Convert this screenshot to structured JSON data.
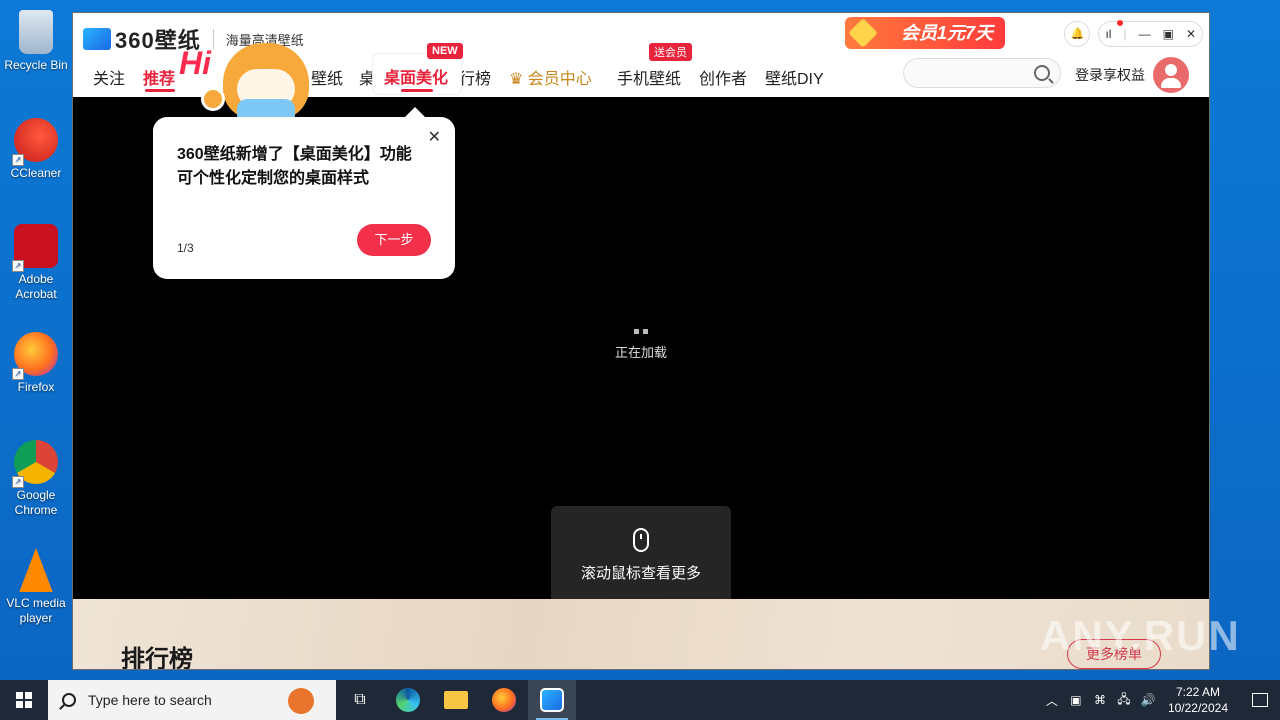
{
  "desktop": {
    "icons": [
      {
        "label": "Recycle Bin"
      },
      {
        "label": "CCleaner"
      },
      {
        "label": "Adobe Acrobat"
      },
      {
        "label": "Firefox"
      },
      {
        "label": "Google Chrome"
      },
      {
        "label": "VLC media player"
      }
    ]
  },
  "app": {
    "brand": "360壁纸",
    "slogan": "海量高清壁纸",
    "promo": "会员1元7天",
    "nav": {
      "follow": "关注",
      "recommend": "推荐",
      "hidden_wallpaper": "壁纸",
      "hidden_desk": "桌",
      "beauty": "桌面美化",
      "rank": "行榜",
      "vip": "会员中心",
      "mobile": "手机壁纸",
      "creator": "创作者",
      "diy": "壁纸DIY"
    },
    "tags": {
      "new": "NEW",
      "gift": "送会员"
    },
    "search_placeholder": "",
    "login": "登录享权益",
    "mascot_hi": "Hi",
    "popup": {
      "line1": "360壁纸新增了【桌面美化】功能",
      "line2": "可个性化定制您的桌面样式",
      "step": "1/3",
      "next": "下一步",
      "close": "✕"
    },
    "loading": "正在加载",
    "scroll_hint": "滚动鼠标查看更多",
    "ranking_title": "排行榜",
    "more_ranking": "更多榜单"
  },
  "watermark": "ANY.RUN",
  "taskbar": {
    "search_placeholder": "Type here to search",
    "time": "7:22 AM",
    "date": "10/22/2024"
  },
  "colors": {
    "accent": "#e8233c",
    "desktop": "#0b6fca",
    "taskbar": "#1f2836"
  }
}
